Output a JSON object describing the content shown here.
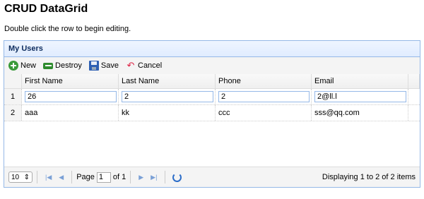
{
  "page": {
    "title": "CRUD DataGrid",
    "description": "Double click the row to begin editing."
  },
  "panel": {
    "title": "My Users"
  },
  "toolbar": {
    "new_label": "New",
    "destroy_label": "Destroy",
    "save_label": "Save",
    "cancel_label": "Cancel"
  },
  "grid": {
    "columns": [
      "First Name",
      "Last Name",
      "Phone",
      "Email"
    ],
    "rows": [
      {
        "num": "1",
        "firstname": "26",
        "lastname": "2",
        "phone": "2",
        "email": "2@ll.l"
      },
      {
        "num": "2",
        "firstname": "aaa",
        "lastname": "kk",
        "phone": "ccc",
        "email": "sss@qq.com"
      }
    ]
  },
  "pager": {
    "page_size": "10",
    "page_label": "Page",
    "page_value": "1",
    "of_label": "of 1",
    "info": "Displaying 1 to 2 of 2 items"
  }
}
